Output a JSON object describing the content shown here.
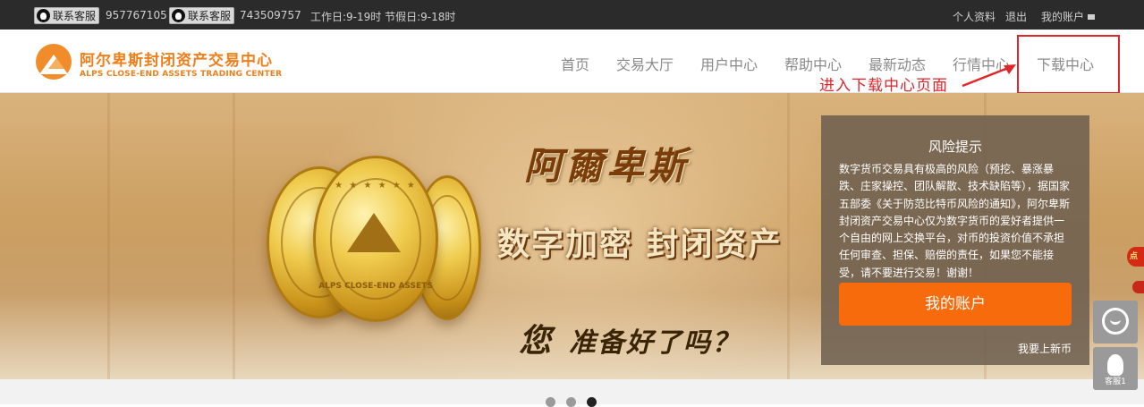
{
  "topbar": {
    "qq1_label": "联系客服",
    "qq1_number": "957767105",
    "qq2_label": "联系客服",
    "qq2_number": "743509757",
    "hours": "工作日:9-19时 节假日:9-18时",
    "profile": "个人资料",
    "logout": "退出",
    "account": "我的账户"
  },
  "logo": {
    "name_cn": "阿尔卑斯封闭资产交易中心",
    "name_en": "ALPS CLOSE-END ASSETS TRADING CENTER"
  },
  "nav": {
    "items": [
      "首页",
      "交易大厅",
      "用户中心",
      "帮助中心",
      "最新动态",
      "行情中心",
      "下载中心"
    ]
  },
  "annotation": {
    "text": "进入下载中心页面",
    "color": "#e0262a"
  },
  "banner": {
    "brand_title": "阿爾卑斯",
    "slogan": "数字加密 封闭资产",
    "question_first": "您",
    "question_rest": "准备好了吗？",
    "coin_text": "ALPS CLOSE-END ASSETS",
    "coin_stars": "★ ★ ★ ★ ★ ★"
  },
  "risk": {
    "title": "风险提示",
    "text": "数字货币交易具有极高的风险（预挖、暴涨暴跌、庄家操控、团队解散、技术缺陷等），据国家五部委《关于防范比特币风险的通知》，阿尔卑斯封闭资产交易中心仅为数字货币的爱好者提供一个自由的网上交换平台，对币的投资价值不承担任何审查、担保、赔偿的责任，如果您不能接受，请不要进行交易！谢谢！",
    "button": "我的账户",
    "link": "我要上新币",
    "button_color": "#f86b0c"
  },
  "carousel": {
    "active_index": 2,
    "count": 3
  },
  "float": {
    "promo_text": "点击",
    "service_label": "客服1"
  },
  "colors": {
    "brand_orange": "#ef7f1a",
    "topbar_bg": "#2b2b2b",
    "nav_text": "#8a8a8a"
  }
}
